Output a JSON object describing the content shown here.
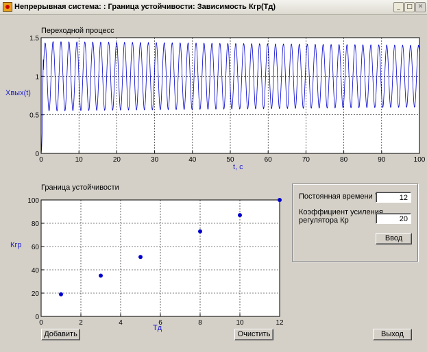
{
  "window": {
    "title": "Непрерывная система: : Граница устойчивости: Зависимость Кгр(Тд)",
    "minimize_glyph": "_",
    "maximize_glyph": "□",
    "close_glyph": "✕"
  },
  "plot1": {
    "title": "Переходной процесс",
    "ylabel": "Хвых(t)",
    "xlabel": "t, c",
    "xticks": [
      "0",
      "10",
      "20",
      "30",
      "40",
      "50",
      "60",
      "70",
      "80",
      "90",
      "100"
    ],
    "yticks": [
      "0",
      "0.5",
      "1",
      "1.5"
    ]
  },
  "plot2": {
    "title": "Граница устойчивости",
    "ylabel": "Кгр",
    "xlabel": "Тд",
    "xticks": [
      "0",
      "2",
      "4",
      "6",
      "8",
      "10",
      "12"
    ],
    "yticks": [
      "0",
      "20",
      "40",
      "60",
      "80",
      "100"
    ]
  },
  "controls": {
    "td_label": "Постоянная времени Тд",
    "td_value": "12",
    "kp_label_line1": "Коэффициент усиления",
    "kp_label_line2": "регулятора Кр",
    "kp_value": "20",
    "enter_button": "Ввод",
    "add_button": "Добавить",
    "clear_button": "Очистить",
    "exit_button": "Выход"
  },
  "chart_data": [
    {
      "type": "line",
      "title": "Переходной процесс",
      "xlabel": "t, c",
      "ylabel": "Хвых(t)",
      "xlim": [
        0,
        100
      ],
      "ylim": [
        0,
        1.5
      ],
      "grid": true,
      "series": [
        {
          "description_of_shape": "sustained oscillation around 1",
          "oscillation_center": 1.0,
          "amplitude_start": 0.45,
          "amplitude_end": 0.4,
          "period": 2.1,
          "rise_from": 0
        }
      ],
      "color": "#0000cc"
    },
    {
      "type": "scatter",
      "title": "Граница устойчивости",
      "xlabel": "Тд",
      "ylabel": "Кгр",
      "xlim": [
        0,
        12
      ],
      "ylim": [
        0,
        100
      ],
      "grid": true,
      "x": [
        1,
        3,
        5,
        8,
        10,
        12
      ],
      "y": [
        19,
        35,
        51,
        73,
        87,
        100
      ],
      "color": "#0000cc"
    }
  ]
}
